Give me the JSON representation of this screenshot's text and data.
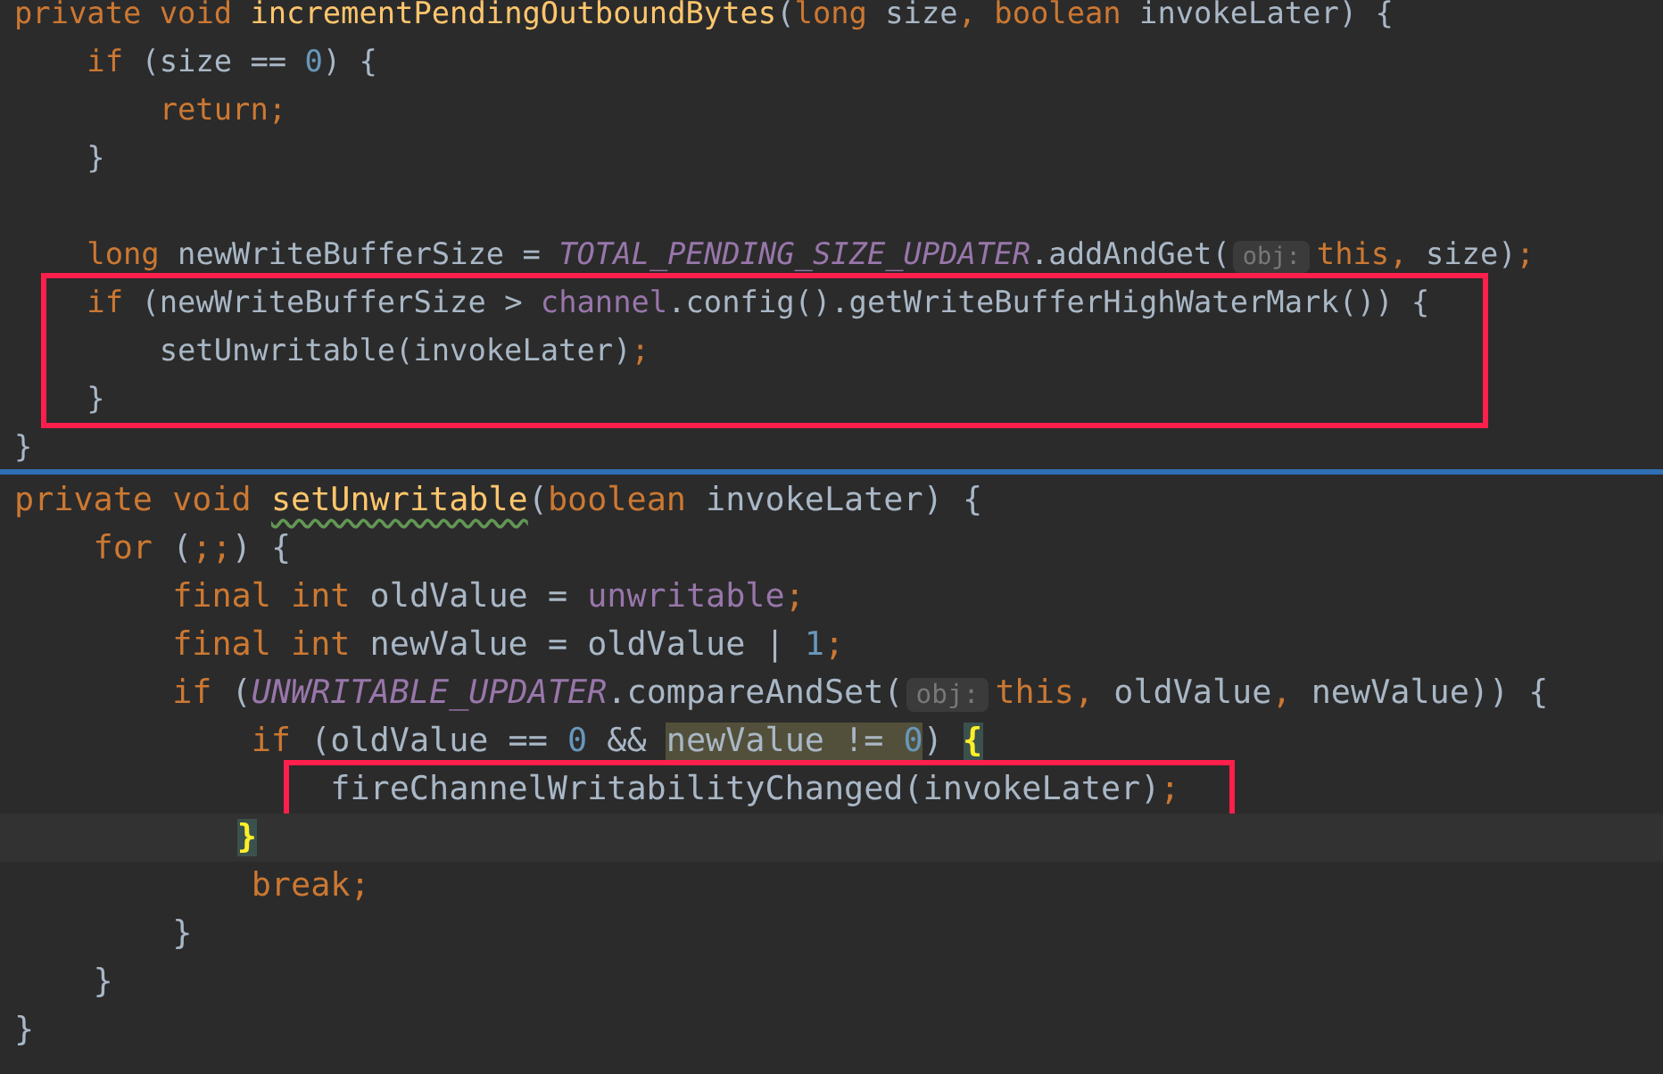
{
  "panels": [
    {
      "lines": [
        {
          "boxed": false,
          "current": false,
          "tokens": [
            {
              "kind": "keyword",
              "text": "private void "
            },
            {
              "kind": "method",
              "text": "incrementPendingOutboundBytes"
            },
            {
              "kind": "plain",
              "text": "("
            },
            {
              "kind": "keyword",
              "text": "long "
            },
            {
              "kind": "plain",
              "text": "size"
            },
            {
              "kind": "keyword",
              "text": ", boolean "
            },
            {
              "kind": "plain",
              "text": "invokeLater) {"
            }
          ],
          "children": [
            {
              "boxed": false,
              "current": false,
              "tokens": [
                {
                  "kind": "keyword",
                  "text": "if "
                },
                {
                  "kind": "plain",
                  "text": "(size == "
                },
                {
                  "kind": "number",
                  "text": "0"
                },
                {
                  "kind": "plain",
                  "text": ") {"
                }
              ],
              "children": [
                {
                  "boxed": false,
                  "current": false,
                  "tokens": [
                    {
                      "kind": "keyword",
                      "text": "return;"
                    }
                  ]
                }
              ]
            },
            {
              "boxed": false,
              "current": false,
              "tokens": [
                {
                  "kind": "plain",
                  "text": "}"
                }
              ]
            },
            {
              "boxed": false,
              "current": false
            },
            {
              "boxed": false,
              "current": false,
              "tokens": [
                {
                  "kind": "keyword",
                  "text": "long "
                },
                {
                  "kind": "plain",
                  "text": "newWriteBufferSize = "
                },
                {
                  "kind": "constant",
                  "text": "TOTAL_PENDING_SIZE_UPDATER"
                },
                {
                  "kind": "plain",
                  "text": ".addAndGet("
                },
                {
                  "kind": "hint",
                  "text": "obj:"
                },
                {
                  "kind": "keyword",
                  "text": "this, "
                },
                {
                  "kind": "plain",
                  "text": "size)"
                },
                {
                  "kind": "keyword",
                  "text": ";"
                }
              ]
            },
            {
              "boxed": true,
              "current": false,
              "tokens": [
                {
                  "kind": "keyword",
                  "text": "if "
                },
                {
                  "kind": "plain",
                  "text": "(newWriteBufferSize > "
                },
                {
                  "kind": "field",
                  "text": "channel"
                },
                {
                  "kind": "plain",
                  "text": ".config().getWriteBufferHighWaterMark()) {"
                }
              ],
              "children": [
                {
                  "boxed": true,
                  "current": false,
                  "tokens": [
                    {
                      "kind": "plain",
                      "text": "setUnwritable(invokeLater)"
                    },
                    {
                      "kind": "keyword",
                      "text": ";"
                    }
                  ]
                }
              ]
            },
            {
              "boxed": true,
              "current": false,
              "tokens": [
                {
                  "kind": "plain",
                  "text": "}"
                }
              ]
            }
          ]
        },
        {
          "boxed": false,
          "current": false,
          "tokens": [
            {
              "kind": "plain",
              "text": "}"
            }
          ]
        }
      ]
    },
    {
      "lines": [
        {
          "boxed": false,
          "current": false,
          "tokens": [
            {
              "kind": "keyword",
              "text": "private void "
            },
            {
              "kind": "method-warning",
              "text": "setUnwritable"
            },
            {
              "kind": "plain",
              "text": "("
            },
            {
              "kind": "keyword",
              "text": "boolean "
            },
            {
              "kind": "plain",
              "text": "invokeLater) {"
            }
          ],
          "children": [
            {
              "boxed": false,
              "current": false,
              "tokens": [
                {
                  "kind": "keyword",
                  "text": "for "
                },
                {
                  "kind": "plain",
                  "text": "("
                },
                {
                  "kind": "keyword",
                  "text": ";;"
                },
                {
                  "kind": "plain",
                  "text": ") {"
                }
              ],
              "children": [
                {
                  "boxed": false,
                  "current": false,
                  "tokens": [
                    {
                      "kind": "keyword",
                      "text": "final int "
                    },
                    {
                      "kind": "plain",
                      "text": "oldValue = "
                    },
                    {
                      "kind": "field",
                      "text": "unwritable"
                    },
                    {
                      "kind": "keyword",
                      "text": ";"
                    }
                  ]
                },
                {
                  "boxed": false,
                  "current": false,
                  "tokens": [
                    {
                      "kind": "keyword",
                      "text": "final int "
                    },
                    {
                      "kind": "plain",
                      "text": "newValue = oldValue | "
                    },
                    {
                      "kind": "number",
                      "text": "1"
                    },
                    {
                      "kind": "keyword",
                      "text": ";"
                    }
                  ]
                },
                {
                  "boxed": false,
                  "current": false,
                  "tokens": [
                    {
                      "kind": "keyword",
                      "text": "if "
                    },
                    {
                      "kind": "plain",
                      "text": "("
                    },
                    {
                      "kind": "constant",
                      "text": "UNWRITABLE_UPDATER"
                    },
                    {
                      "kind": "plain",
                      "text": ".compareAndSet("
                    },
                    {
                      "kind": "hint",
                      "text": "obj:"
                    },
                    {
                      "kind": "keyword",
                      "text": "this, "
                    },
                    {
                      "kind": "plain",
                      "text": "oldValue"
                    },
                    {
                      "kind": "keyword",
                      "text": ", "
                    },
                    {
                      "kind": "plain",
                      "text": "newValue)) {"
                    }
                  ],
                  "children": [
                    {
                      "boxed": false,
                      "current": false,
                      "tokens": [
                        {
                          "kind": "keyword",
                          "text": "if "
                        },
                        {
                          "kind": "plain",
                          "text": "(oldValue == "
                        },
                        {
                          "kind": "number",
                          "text": "0"
                        },
                        {
                          "kind": "plain",
                          "text": " && "
                        },
                        {
                          "kind": "usage",
                          "text": "newValue != "
                        },
                        {
                          "kind": "usage-number",
                          "text": "0"
                        },
                        {
                          "kind": "plain",
                          "text": ") "
                        },
                        {
                          "kind": "brace-match",
                          "text": "{"
                        }
                      ],
                      "children": [
                        {
                          "boxed": true,
                          "current": false,
                          "tokens": [
                            {
                              "kind": "plain",
                              "text": "fireChannelWritabilityChanged(invokeLater)"
                            },
                            {
                              "kind": "keyword",
                              "text": ";"
                            }
                          ]
                        }
                      ]
                    },
                    {
                      "boxed": false,
                      "current": true,
                      "tokens": [
                        {
                          "kind": "brace-match",
                          "text": "}"
                        }
                      ]
                    },
                    {
                      "boxed": false,
                      "current": false,
                      "tokens": [
                        {
                          "kind": "keyword",
                          "text": "break;"
                        }
                      ]
                    }
                  ]
                },
                {
                  "boxed": false,
                  "current": false,
                  "tokens": [
                    {
                      "kind": "plain",
                      "text": "}"
                    }
                  ]
                }
              ]
            },
            {
              "boxed": false,
              "current": false,
              "tokens": [
                {
                  "kind": "plain",
                  "text": "}"
                }
              ]
            }
          ]
        },
        {
          "boxed": false,
          "current": false,
          "tokens": [
            {
              "kind": "plain",
              "text": "}"
            }
          ]
        }
      ]
    }
  ]
}
